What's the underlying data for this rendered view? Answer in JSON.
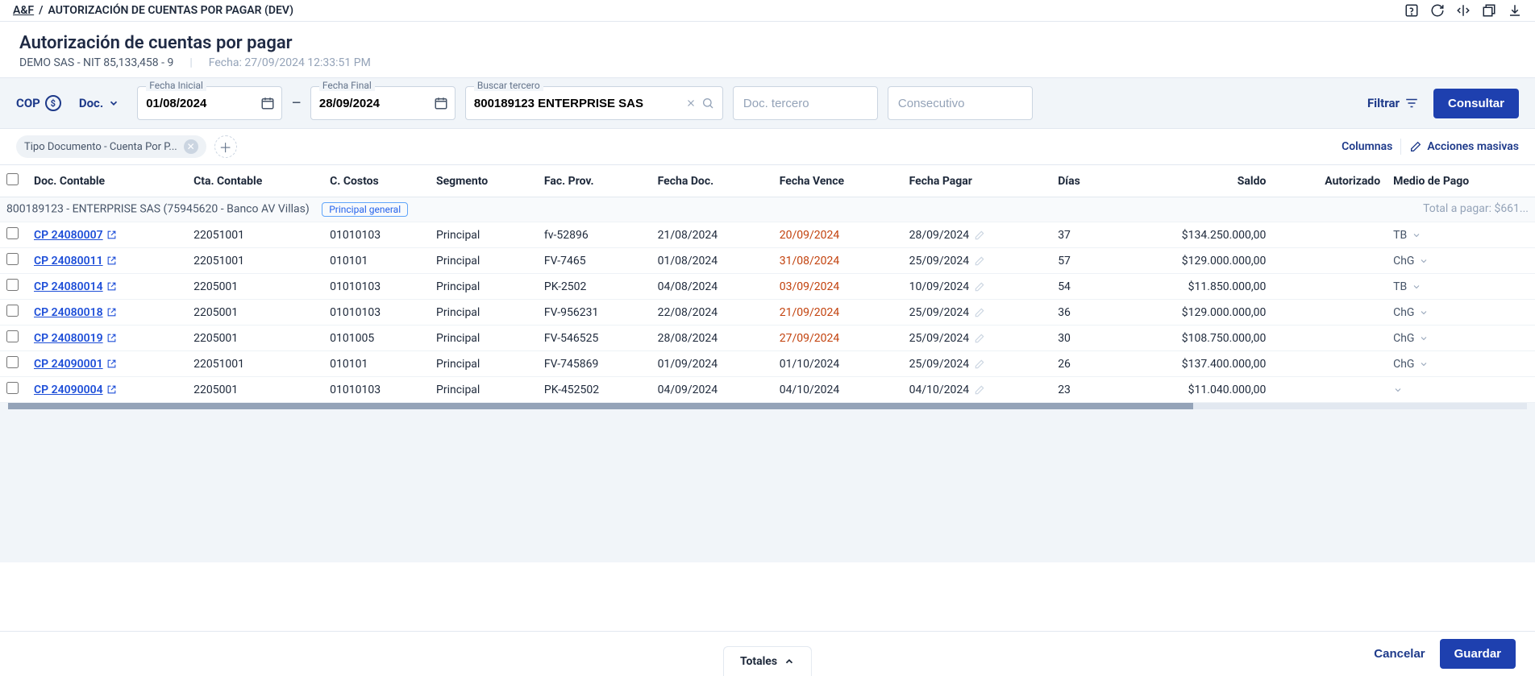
{
  "breadcrumb": {
    "root": "A&F",
    "sep": "/",
    "page": "AUTORIZACIÓN DE CUENTAS POR PAGAR (DEV)"
  },
  "header": {
    "title": "Autorización de cuentas por pagar",
    "company": "DEMO SAS - NIT 85,133,458 - 9",
    "timestamp_label": "Fecha:",
    "timestamp": "27/09/2024 12:33:51 PM"
  },
  "filter": {
    "currency": "COP",
    "doc_label": "Doc.",
    "date_from_label": "Fecha Inicial",
    "date_from": "01/08/2024",
    "date_to_label": "Fecha Final",
    "date_to": "28/09/2024",
    "search_label": "Buscar tercero",
    "search_value": "800189123 ENTERPRISE SAS",
    "doc_tercero_ph": "Doc. tercero",
    "consecutivo_ph": "Consecutivo",
    "filtrar": "Filtrar",
    "consultar": "Consultar"
  },
  "chips": {
    "tipo_doc": "Tipo Documento - Cuenta Por P..."
  },
  "actions": {
    "columnas": "Columnas",
    "masivas": "Acciones masivas"
  },
  "columns": {
    "doc": "Doc. Contable",
    "cta": "Cta. Contable",
    "cc": "C. Costos",
    "seg": "Segmento",
    "fac": "Fac. Prov.",
    "fdoc": "Fecha Doc.",
    "fven": "Fecha Vence",
    "fpag": "Fecha Pagar",
    "dias": "Días",
    "saldo": "Saldo",
    "aut": "Autorizado",
    "medio": "Medio de Pago"
  },
  "group": {
    "title": "800189123 - ENTERPRISE SAS (75945620 - Banco AV Villas)",
    "badge": "Principal general",
    "total_label": "Total a pagar: $661..."
  },
  "rows": [
    {
      "doc": "CP 24080007",
      "cta": "22051001",
      "cc": "01010103",
      "seg": "Principal",
      "fac": "fv-52896",
      "fdoc": "21/08/2024",
      "fven": "20/09/2024",
      "overdue": true,
      "fpag": "28/09/2024",
      "dias": "37",
      "saldo": "$134.250.000,00",
      "medio": "TB"
    },
    {
      "doc": "CP 24080011",
      "cta": "22051001",
      "cc": "010101",
      "seg": "Principal",
      "fac": "FV-7465",
      "fdoc": "01/08/2024",
      "fven": "31/08/2024",
      "overdue": true,
      "fpag": "25/09/2024",
      "dias": "57",
      "saldo": "$129.000.000,00",
      "medio": "ChG"
    },
    {
      "doc": "CP 24080014",
      "cta": "2205001",
      "cc": "01010103",
      "seg": "Principal",
      "fac": "PK-2502",
      "fdoc": "04/08/2024",
      "fven": "03/09/2024",
      "overdue": true,
      "fpag": "10/09/2024",
      "dias": "54",
      "saldo": "$11.850.000,00",
      "medio": "TB"
    },
    {
      "doc": "CP 24080018",
      "cta": "2205001",
      "cc": "01010103",
      "seg": "Principal",
      "fac": "FV-956231",
      "fdoc": "22/08/2024",
      "fven": "21/09/2024",
      "overdue": true,
      "fpag": "25/09/2024",
      "dias": "36",
      "saldo": "$129.000.000,00",
      "medio": "ChG"
    },
    {
      "doc": "CP 24080019",
      "cta": "2205001",
      "cc": "0101005",
      "seg": "Principal",
      "fac": "FV-546525",
      "fdoc": "28/08/2024",
      "fven": "27/09/2024",
      "overdue": true,
      "fpag": "25/09/2024",
      "dias": "30",
      "saldo": "$108.750.000,00",
      "medio": "ChG"
    },
    {
      "doc": "CP 24090001",
      "cta": "22051001",
      "cc": "010101",
      "seg": "Principal",
      "fac": "FV-745869",
      "fdoc": "01/09/2024",
      "fven": "01/10/2024",
      "overdue": false,
      "fpag": "25/09/2024",
      "dias": "26",
      "saldo": "$137.400.000,00",
      "medio": "ChG"
    },
    {
      "doc": "CP 24090004",
      "cta": "2205001",
      "cc": "01010103",
      "seg": "Principal",
      "fac": "PK-452502",
      "fdoc": "04/09/2024",
      "fven": "04/10/2024",
      "overdue": false,
      "fpag": "04/10/2024",
      "dias": "23",
      "saldo": "$11.040.000,00",
      "medio": ""
    }
  ],
  "footer": {
    "totales": "Totales",
    "cancelar": "Cancelar",
    "guardar": "Guardar"
  }
}
